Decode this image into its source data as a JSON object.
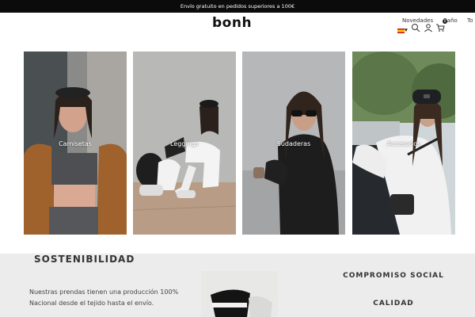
{
  "promo_bar": {
    "text": "Envío gratuito en pedidos superiores a 100€"
  },
  "header": {
    "logo": "bonh",
    "nav": [
      "Novedades",
      "Baño",
      "To"
    ],
    "icons": [
      "flag-es-icon",
      "search-icon",
      "user-icon",
      "cart-icon"
    ],
    "cart_count": "0"
  },
  "categories": [
    {
      "label": "Camisetas"
    },
    {
      "label": "Leggings"
    },
    {
      "label": "Sudaderas"
    },
    {
      "label": "Accesorios"
    }
  ],
  "sustainability": {
    "title": "SOSTENIBILIDAD",
    "text": "Nuestras prendas tienen una producción 100% Nacional desde el tejido hasta el envío."
  },
  "right_column": {
    "headings": [
      "COMPROMISO SOCIAL",
      "CALIDAD"
    ]
  },
  "colors": {
    "promo_bg": "#0b0b0b",
    "footer_bg": "#ececec",
    "text_dark": "#222222"
  }
}
